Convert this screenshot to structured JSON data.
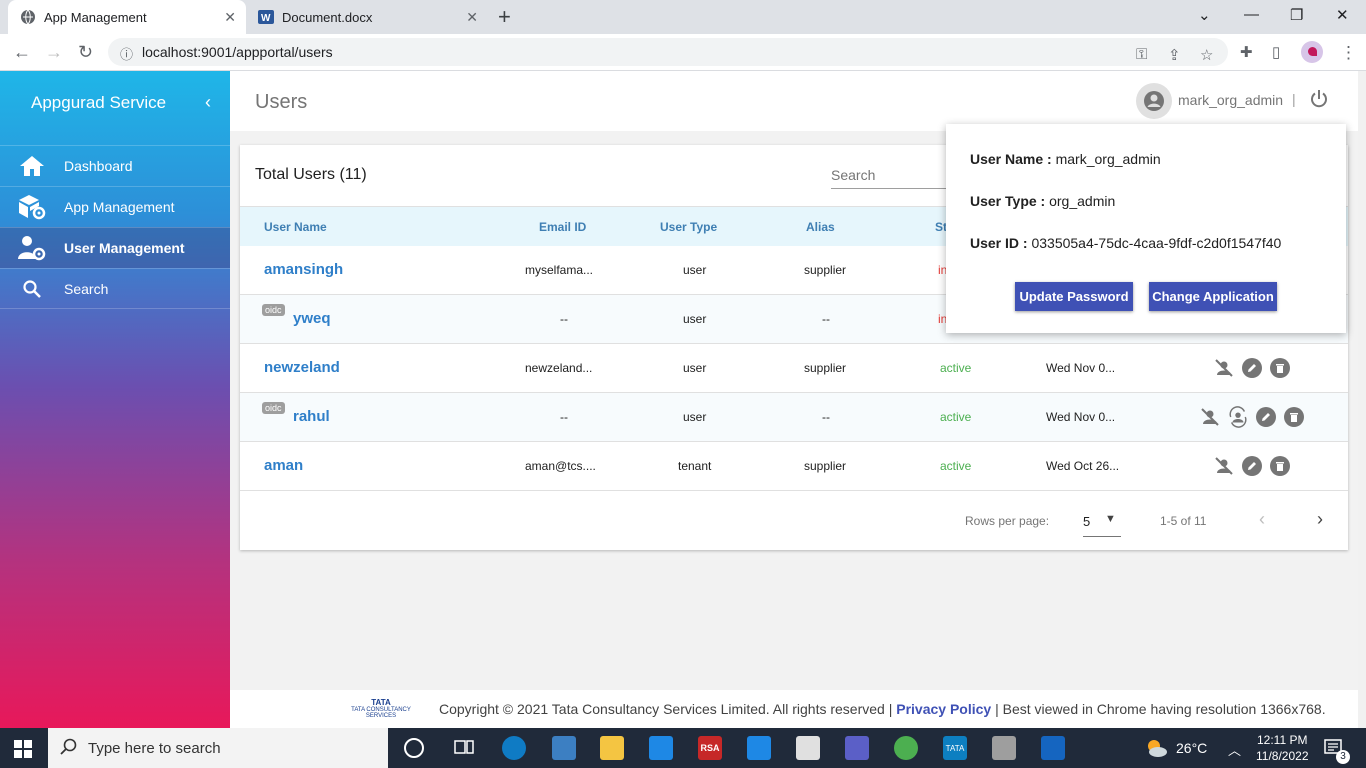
{
  "browser": {
    "tabs": [
      {
        "label": "App Management"
      },
      {
        "label": "Document.docx"
      }
    ],
    "url": "localhost:9001/appportal/users"
  },
  "sidebar": {
    "title": "Appgurad Service",
    "items": [
      {
        "label": "Dashboard"
      },
      {
        "label": "App Management"
      },
      {
        "label": "User Management"
      },
      {
        "label": "Search"
      }
    ]
  },
  "header": {
    "page_title": "Users",
    "username": "mark_org_admin",
    "separator": "|"
  },
  "users_card": {
    "title": "Total Users (11)",
    "search_placeholder": "Search",
    "columns": [
      "User Name",
      "Email ID",
      "User Type",
      "Alias",
      "St"
    ],
    "rows": [
      {
        "name": "amansingh",
        "oidc": "",
        "email": "myselfama...",
        "type": "user",
        "alias": "supplier",
        "status": "in",
        "date": ""
      },
      {
        "name": "yweq",
        "oidc": "oidc",
        "email": "--",
        "type": "user",
        "alias": "--",
        "status": "in",
        "date": ""
      },
      {
        "name": "newzeland",
        "oidc": "",
        "email": "newzeland...",
        "type": "user",
        "alias": "supplier",
        "status": "active",
        "date": "Wed Nov 0..."
      },
      {
        "name": "rahul",
        "oidc": "oidc",
        "email": "--",
        "type": "user",
        "alias": "--",
        "status": "active",
        "date": "Wed Nov 0..."
      },
      {
        "name": "aman",
        "oidc": "",
        "email": "aman@tcs....",
        "type": "tenant",
        "alias": "supplier",
        "status": "active",
        "date": "Wed Oct 26..."
      }
    ],
    "pagination": {
      "rows_per_page_label": "Rows per page:",
      "rows_per_page": "5",
      "range": "1-5 of 11"
    }
  },
  "user_popover": {
    "name_label": "User Name :",
    "name_value": "mark_org_admin",
    "type_label": "User Type :",
    "type_value": "org_admin",
    "id_label": "User ID :",
    "id_value": "033505a4-75dc-4caa-9fdf-c2d0f1547f40",
    "update_password": "Update Password",
    "change_application": "Change Application"
  },
  "footer": {
    "copyright": "Copyright © 2021 Tata Consultancy Services Limited. All rights reserved |",
    "privacy": "Privacy Policy",
    "suffix": "| Best viewed in Chrome having resolution 1366x768.",
    "logo_text": "TATA CONSULTANCY SERVICES",
    "logo_mark": "TATA"
  },
  "taskbar": {
    "search_placeholder": "Type here to search",
    "temperature": "26°C",
    "time": "12:11 PM",
    "date": "11/8/2022",
    "notifications": "3",
    "rsa_label": "RSA",
    "tata_label": "TATA"
  },
  "colors": {
    "accent": "#3f51b5",
    "link": "#2f7fc9",
    "active": "#4caf50",
    "inactive": "#e53935"
  }
}
